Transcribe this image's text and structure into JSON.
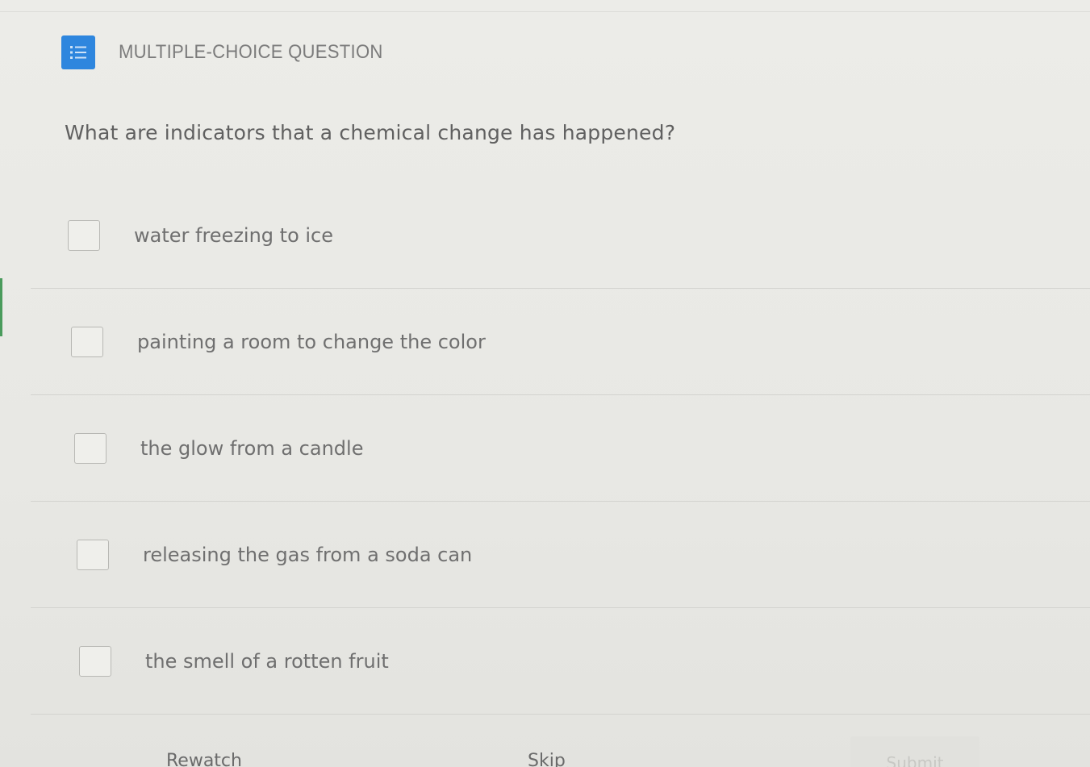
{
  "header": {
    "icon": "list-icon",
    "label": "MULTIPLE-CHOICE QUESTION",
    "icon_color": "#2e86de"
  },
  "question": {
    "text": "What are indicators that a chemical change has happened?"
  },
  "options": [
    {
      "label": "water freezing to ice",
      "checked": false
    },
    {
      "label": "painting a room to change the color",
      "checked": false
    },
    {
      "label": "the glow from a candle",
      "checked": false
    },
    {
      "label": "releasing the gas from a soda can",
      "checked": false
    },
    {
      "label": "the smell of a rotten fruit",
      "checked": false
    }
  ],
  "footer": {
    "rewatch_label": "Rewatch",
    "skip_label": "Skip",
    "submit_label": "Submit"
  }
}
